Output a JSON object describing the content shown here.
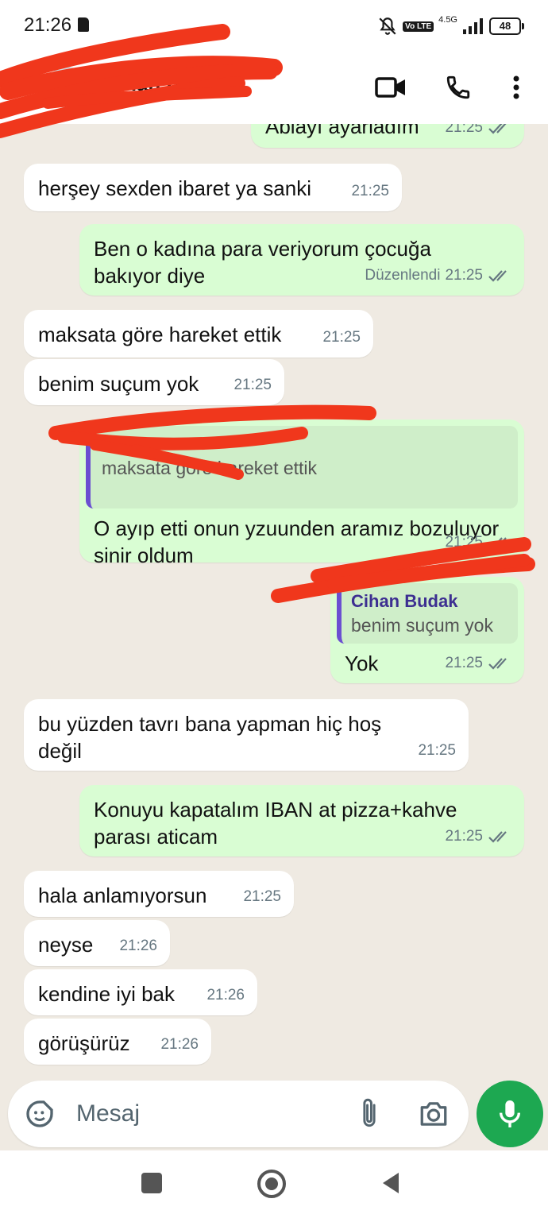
{
  "status_bar": {
    "time": "21:26",
    "network": "4.5G",
    "volte": "Vo LTE",
    "battery": "48"
  },
  "header": {
    "contact_name": "Cihan Bu"
  },
  "messages": [
    {
      "text": "Ablayı ayarladım",
      "time": "21:25"
    },
    {
      "text": "herşey sexden ibaret ya sanki",
      "time": "21:25"
    },
    {
      "text": "Ben o kadına para veriyorum çocuğa bakıyor diye",
      "edited": "Düzenlendi",
      "time": "21:25"
    },
    {
      "text": "maksata göre hareket ettik",
      "time": "21:25"
    },
    {
      "text": "benim suçum yok",
      "time": "21:25"
    },
    {
      "quote_text": "maksata göre hareket ettik",
      "text": "O ayıp etti onun yzuunden aramız bozuluyor sinir oldum",
      "time": "21:25"
    },
    {
      "quote_name": "Cihan Budak",
      "quote_text": "benim suçum yok",
      "text": "Yok",
      "time": "21:25"
    },
    {
      "text": "bu yüzden tavrı bana yapman hiç hoş değil",
      "time": "21:25"
    },
    {
      "text": "Konuyu kapatalım IBAN at pizza+kahve parası aticam",
      "time": "21:25"
    },
    {
      "text": "hala anlamıyorsun",
      "time": "21:25"
    },
    {
      "text": "neyse",
      "time": "21:26"
    },
    {
      "text": "kendine iyi bak",
      "time": "21:26"
    },
    {
      "text": "görüşürüz",
      "time": "21:26"
    }
  ],
  "input": {
    "placeholder": "Mesaj"
  },
  "colors": {
    "outgoing": "#d9fdd3",
    "incoming": "#ffffff",
    "accent": "#1da851",
    "scribble": "#f0371c"
  }
}
